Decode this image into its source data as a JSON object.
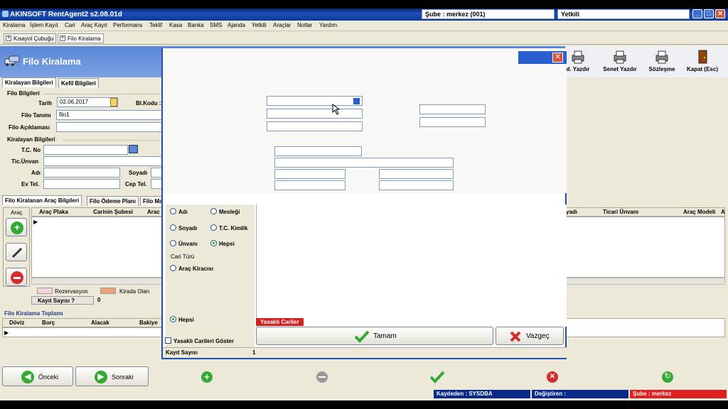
{
  "window": {
    "title": "AKINSOFT RentAgent2 s2.08.01d",
    "branch_field": "Şube : merkez (001)",
    "auth_field": "Yetkili"
  },
  "menu": [
    "Kiralama",
    "İşlem Kayıt",
    "Cari",
    "Araç Kayıt",
    "Performans",
    "Teklif",
    "Kasa",
    "Banka",
    "SMS",
    "Ajanda",
    "Yetkili",
    "Araçlar",
    "Notlar",
    "Yardım"
  ],
  "doc_tabs": [
    "Kısayol Çubuğu",
    "Filo Kiralama"
  ],
  "header": {
    "title": "Filo Kiralama",
    "tools": [
      {
        "label": "d. Yazdır",
        "icon": "printer-icon"
      },
      {
        "label": "Senet Yazdır",
        "icon": "printer-icon"
      },
      {
        "label": "Sözleşme",
        "icon": "printer-icon"
      },
      {
        "label": "Kapat (Esc)",
        "icon": "door-exit-icon"
      }
    ]
  },
  "form_tabs": [
    "Kiralayan Bilgileri",
    "Kefil Bilgileri"
  ],
  "filo_bilgileri": {
    "group": "Filo Bilgileri",
    "tarih_label": "Tarih",
    "tarih_value": "02.06.2017",
    "blkodu_label": "Bl.Kodu :",
    "tanimi_label": "Filo Tanımı",
    "tanimi_value": "filo1",
    "aciklama_label": "Filo Açıklaması"
  },
  "kiralayan": {
    "group": "Kiralayan Bilgileri",
    "tc_label": "T.C. No",
    "unvan_label": "Tic.Ünvan",
    "adi_label": "Adı",
    "soyadi_label": "Soyadı",
    "evtel_label": "Ev Tel.",
    "ceptel_label": "Cep Tel."
  },
  "lower_tabs": [
    "Filo Kiralanan Araç Bilgileri",
    "Filo Ödeme Planı",
    "Filo Ma"
  ],
  "arac_grid": {
    "side_label": "Araç",
    "columns": [
      "Araç Plaka",
      "Carinin Şubesi",
      "Arac"
    ]
  },
  "legend": {
    "rezervasyon": "Rezervasyon",
    "kirada": "Kirada Olan",
    "rez_color": "#f5d2dc",
    "kirada_color": "#f0a07d"
  },
  "kayit": {
    "label": "Kayıt Sayısı ?",
    "value": "0"
  },
  "toplam": {
    "title": "Filo Kiralama Toplamı",
    "columns": [
      "Döviz",
      "Borç",
      "Alacak",
      "Bakiye"
    ]
  },
  "right_grid": {
    "columns": [
      "yadı",
      "Ticari Ünvanı",
      "Araç Modeli",
      "A"
    ]
  },
  "dialog": {
    "radios_search": [
      {
        "label": "Adı",
        "on": false
      },
      {
        "label": "Mesleği",
        "on": false
      },
      {
        "label": "Soyadı",
        "on": false
      },
      {
        "label": "T.C. Kimlik",
        "on": false
      },
      {
        "label": "Ünvanı",
        "on": false
      },
      {
        "label": "Hepsi",
        "on": true
      }
    ],
    "cari_turu_label": "Cari Türü",
    "arac_kiracisi": "Araç Kiracısı",
    "hepsi": "Hepsi",
    "yasakli_goster": "Yasaklı Carileri Göster",
    "yasakli_badge": "Yasaklı Cariler",
    "ok_label": "Tamam",
    "cancel_label": "Vazgeç",
    "kayit_label": "Kayıt Sayısı",
    "kayit_value": "1"
  },
  "bottom_nav": {
    "prev": "Önceki",
    "next": "Sonraki"
  },
  "status": {
    "kaydeden": "Kaydeden : SYSDBA",
    "degistiren": "Değiştiren :",
    "sube": "Şube : merkez"
  }
}
